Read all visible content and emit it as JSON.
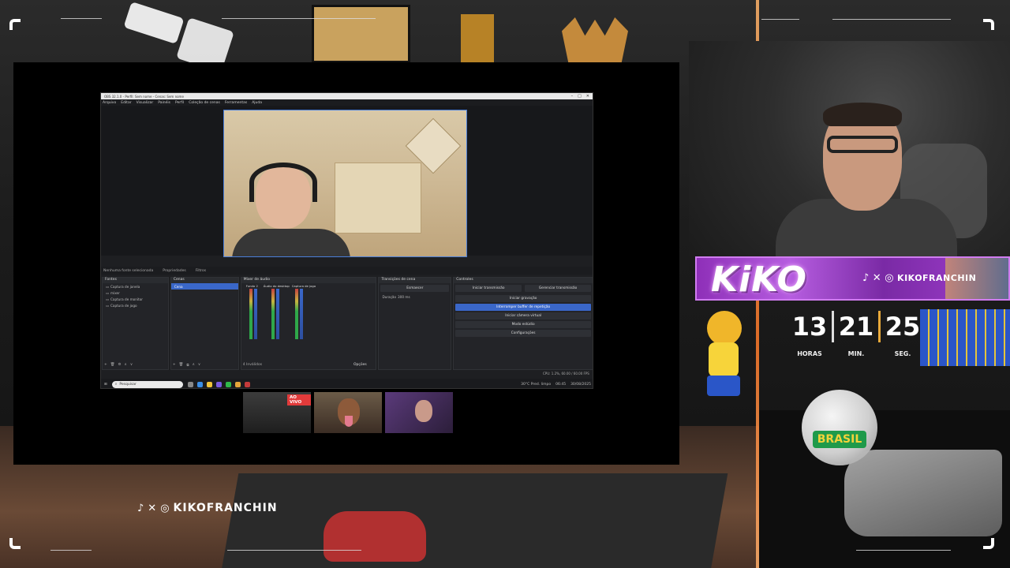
{
  "obs": {
    "title": "OBS 32.1.0 - Perfil: Sem nome - Cenas: Sem nome",
    "window_controls": [
      "–",
      "□",
      "✕"
    ],
    "menu": [
      "Arquivo",
      "Editar",
      "Visualizar",
      "Painéis",
      "Perfil",
      "Coleção de cenas",
      "Ferramentas",
      "Ajuda"
    ],
    "scene_hint": "Nenhuma fonte selecionada",
    "status_tabs": [
      "Propriedades",
      "Filtros"
    ],
    "sources": {
      "title": "Fontes",
      "items": [
        "Captura de janela",
        "mixer",
        "Captura de monitor",
        "Captura de jogo"
      ]
    },
    "scenes": {
      "title": "Cenas",
      "items": [
        "Cena"
      ]
    },
    "mixer": {
      "title": "Mixer de áudio",
      "channels": [
        "Global",
        "Global",
        "Global"
      ],
      "channel_values": [
        "0.0 dB",
        "0.0 dB",
        "0.0 dB"
      ],
      "channel_names": [
        "Fundo 2",
        "Áudio do desktop",
        "Captura de jogo"
      ],
      "footer": "4 Inválidos"
    },
    "transitions": {
      "title": "Transições de cena",
      "type": "Esmaecer",
      "duration_label": "Duração",
      "duration": "300 ms"
    },
    "controls": {
      "title": "Controles",
      "start_stream": "Iniciar transmissão",
      "manage_stream": "Gerenciar transmissão",
      "start_record": "Iniciar gravação",
      "replay_buffer": "Interromper buffer de repetição",
      "virtual_cam": "Iniciar câmera virtual",
      "studio_mode": "Modo estúdio",
      "settings": "Configurações"
    },
    "options_btn": "Opções",
    "statusbar": "CPU: 1.2%, 60.00 / 60.00 FPS",
    "taskbar": {
      "search_placeholder": "Pesquisar",
      "weather": "30°C  Pred. limpo",
      "time": "06:45",
      "date": "30/08/2025"
    }
  },
  "cams": {
    "live_badge": "AO VIVO"
  },
  "banner": {
    "name": "KiKO",
    "handle": "KIKOFRANCHIN"
  },
  "clock": {
    "hours": "13",
    "minutes": "21",
    "seconds": "25",
    "hours_label": "HORAS",
    "minutes_label": "MIN.",
    "seconds_label": "SEG."
  },
  "bottom_social": {
    "handle": "KIKOFRANCHIN"
  },
  "scene_text": {
    "ball_text": "BRASIL"
  },
  "colors": {
    "accent_purple": "#b65de0",
    "obs_blue": "#3a67c9",
    "clock_sep": "#e8a93a",
    "live_red": "#e23b3b"
  }
}
